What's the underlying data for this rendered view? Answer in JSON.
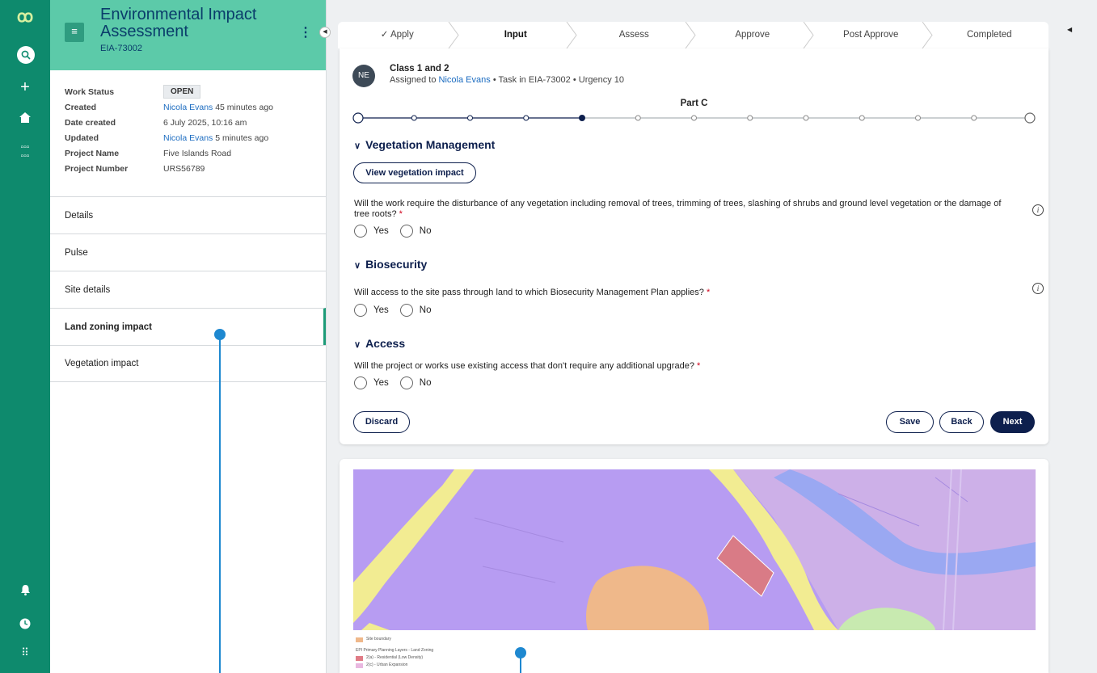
{
  "rail": {
    "icons": [
      "logo-icon",
      "search-icon",
      "plus-icon",
      "home-icon",
      "grid-icon",
      "bell-icon",
      "clock-icon",
      "apps-icon"
    ]
  },
  "panel": {
    "title": "Environmental Impact Assessment",
    "id": "EIA-73002",
    "meta": {
      "work_status_label": "Work Status",
      "work_status": "OPEN",
      "created_label": "Created",
      "created_user": "Nicola Evans",
      "created_ago": "45 minutes ago",
      "date_created_label": "Date created",
      "date_created": "6 July 2025, 10:16 am",
      "updated_label": "Updated",
      "updated_user": "Nicola Evans",
      "updated_ago": "5 minutes ago",
      "project_name_label": "Project Name",
      "project_name": "Five Islands Road",
      "project_number_label": "Project Number",
      "project_number": "URS56789"
    },
    "nav": [
      "Details",
      "Pulse",
      "Site details",
      "Land zoning impact",
      "Vegetation impact"
    ],
    "active_nav": "Land zoning impact"
  },
  "stepper": {
    "steps": [
      "Apply",
      "Input",
      "Assess",
      "Approve",
      "Post Approve",
      "Completed"
    ],
    "current": "Input",
    "completed": [
      "Apply"
    ]
  },
  "task": {
    "avatar": "NE",
    "title": "Class 1 and 2",
    "assigned_prefix": "Assigned to",
    "assignee": "Nicola Evans",
    "details": "• Task in EIA-73002 • Urgency 10"
  },
  "progress": {
    "part_label": "Part C",
    "total_steps": 13,
    "current_step": 5
  },
  "sections": {
    "vegetation": {
      "title": "Vegetation Management",
      "button": "View vegetation impact",
      "question": "Will the work require the disturbance of any vegetation including removal of trees, trimming of trees, slashing of shrubs and ground level vegetation or the damage of tree roots?",
      "yes": "Yes",
      "no": "No"
    },
    "biosecurity": {
      "title": "Biosecurity",
      "question": "Will access to the site pass through land to which Biosecurity Management Plan applies?",
      "yes": "Yes",
      "no": "No"
    },
    "access": {
      "title": "Access",
      "question": "Will the project or works use existing access that don't require any additional upgrade?",
      "yes": "Yes",
      "no": "No"
    }
  },
  "actions": {
    "discard": "Discard",
    "save": "Save",
    "back": "Back",
    "next": "Next"
  },
  "map": {
    "legend": {
      "site_boundary": "Site boundary",
      "layer_title": "EPI Primary Planning Layers - Land Zoning",
      "items": [
        "2(a) - Residential (Low Density)",
        "2(c) - Urban Expansion"
      ]
    },
    "colors": {
      "zoning": "#b79cf2",
      "road": "#f2ec92",
      "water": "#9aa8f2",
      "site": "#d97b86",
      "orange": "#efb88a",
      "green": "#c8eab0"
    }
  },
  "colors": {
    "rail": "#0e8a6d",
    "header": "#5ccaa9",
    "navy": "#0d1f4d",
    "link": "#1a6bc0",
    "marker": "#1e88d0"
  }
}
